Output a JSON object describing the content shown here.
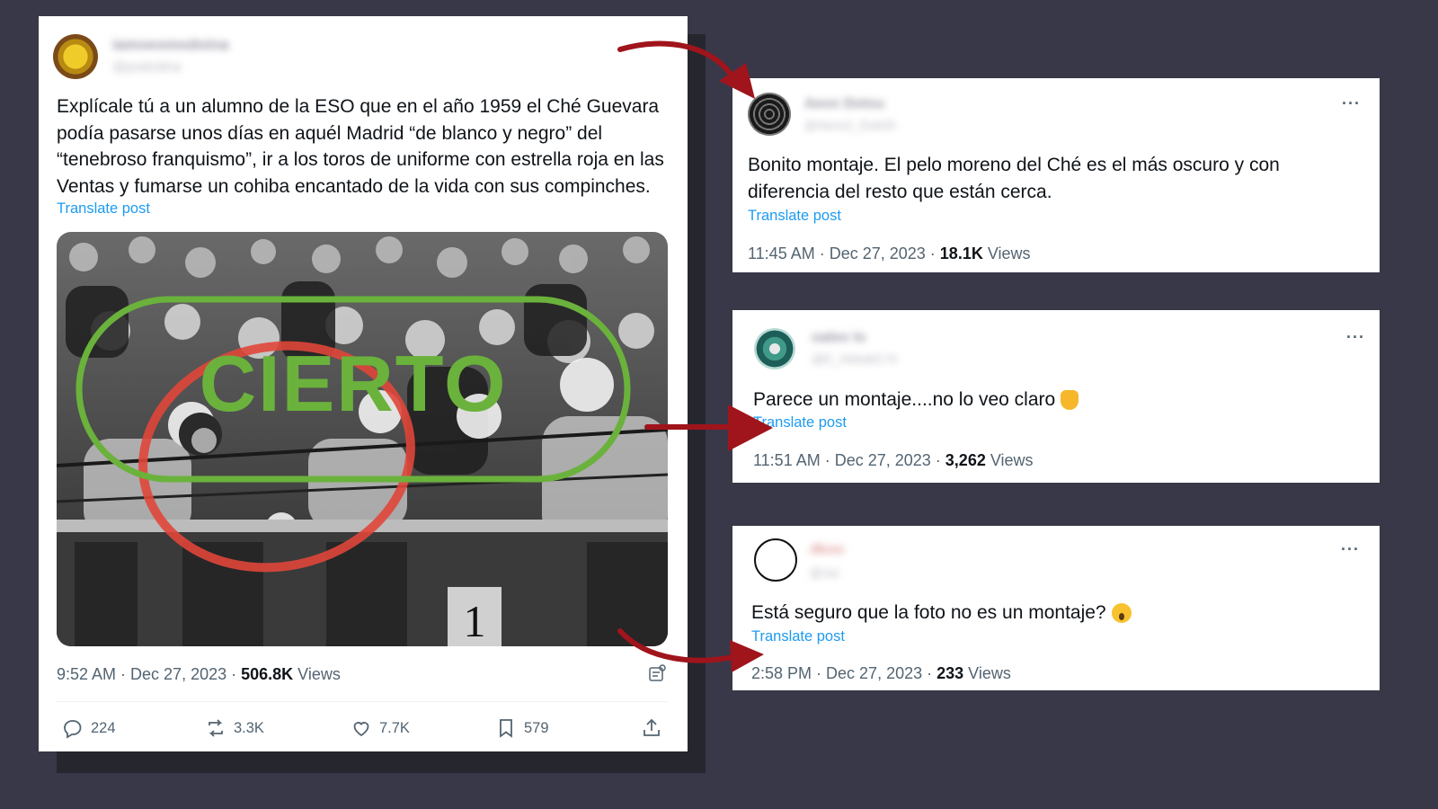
{
  "main_tweet": {
    "display_name": "iamoesmodoina",
    "handle": "@podcidna",
    "text_lines": [
      "Explícale tú a un alumno de la ESO que en el año 1959 el Ché Guevara",
      "podía pasarse unos días en aquél Madrid “de blanco y negro” del",
      "“tenebroso franquismo”, ir a los toros de uniforme con estrella roja en las",
      "Ventas y fumarse un cohiba encantado de la vida con sus compinches."
    ],
    "translate_label": "Translate post",
    "photo_stamp": "CIERTO",
    "time": "9:52 AM · Dec 27, 2023 · ",
    "views_count": "506.8K",
    "views_label": " Views",
    "actions": {
      "replies": "224",
      "reposts": "3.3K",
      "likes": "7.7K",
      "bookmarks": "579"
    }
  },
  "replies": [
    {
      "display_name": "Aeox Dotsu",
      "handle": "@Aeox2_Duk2h",
      "text_lines": [
        "Bonito montaje. El pelo moreno del Ché es el más oscuro y con",
        "diferencia del resto  que están cerca."
      ],
      "translate_label": "Translate post",
      "time": "11:45 AM · Dec 27, 2023 · ",
      "views_count": "18.1K",
      "views_label": " Views"
    },
    {
      "display_name": "oaleo lo",
      "handle": "@E_Hdsdd174",
      "text_lines": [
        "Parece un montaje....no lo veo claro"
      ],
      "translate_label": "Translate post",
      "time": "11:51 AM · Dec 27, 2023 · ",
      "views_count": "3,262",
      "views_label": " Views"
    },
    {
      "display_name": "dkoo",
      "handle": "@Jui",
      "text_lines": [
        "Está seguro que la foto no es un montaje?"
      ],
      "translate_label": "Translate post",
      "time": "2:58 PM · Dec 27, 2023 · ",
      "views_count": "233",
      "views_label": " Views"
    }
  ],
  "colors": {
    "background": "#383849",
    "arrow": "#a0141c",
    "stamp_green": "#6ab23c",
    "circle_red": "#e0463a",
    "link_blue": "#1d9bf0"
  },
  "icons": [
    "reply-icon",
    "repost-icon",
    "like-icon",
    "bookmark-icon",
    "share-icon",
    "grok-icon",
    "more-icon",
    "thumbs-up-emoji",
    "surprised-emoji"
  ]
}
